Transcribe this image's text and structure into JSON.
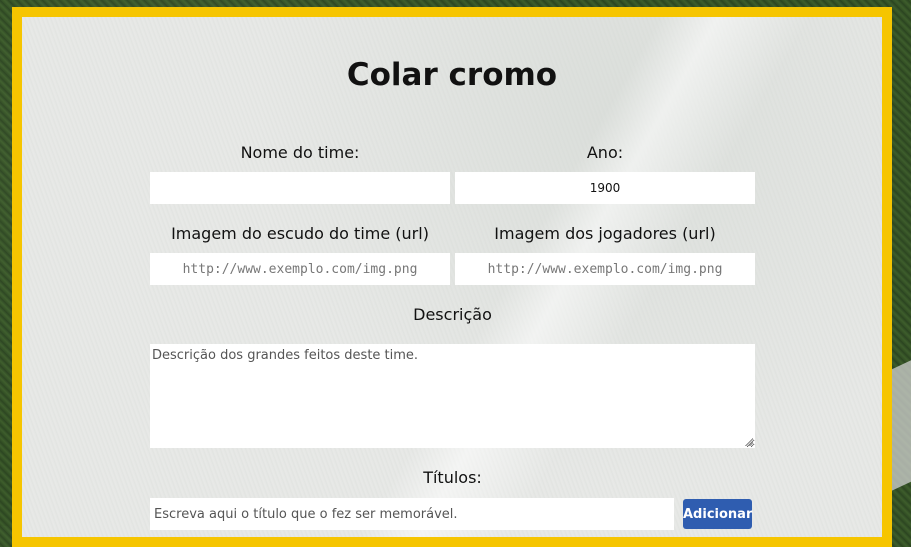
{
  "page": {
    "title": "Colar cromo"
  },
  "form": {
    "team_name": {
      "label": "Nome do time:",
      "value": "",
      "placeholder": ""
    },
    "year": {
      "label": "Ano:",
      "value": "1900"
    },
    "crest_url": {
      "label": "Imagem do escudo do time (url)",
      "placeholder": "http://www.exemplo.com/img.png"
    },
    "players_url": {
      "label": "Imagem dos jogadores (url)",
      "placeholder": "http://www.exemplo.com/img.png"
    },
    "description": {
      "label": "Descrição",
      "placeholder": "Descrição dos grandes feitos deste time."
    },
    "titles": {
      "label": "Títulos:",
      "placeholder": "Escreva aqui o título que o fez ser memorável.",
      "add_button": "Adicionar"
    }
  },
  "colors": {
    "frame_border": "#f6c500",
    "button": "#2f5db0"
  }
}
